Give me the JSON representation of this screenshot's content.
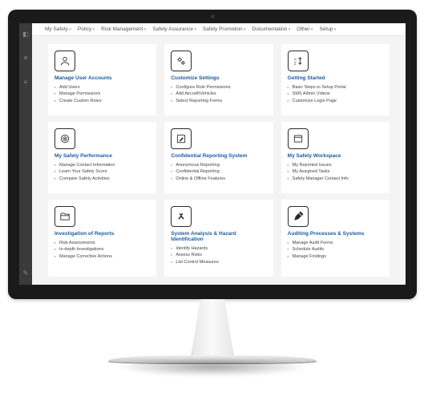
{
  "nav": [
    "My Safety",
    "Policy",
    "Risk Management",
    "Safety Assurance",
    "Safety Promotion",
    "Documentation",
    "Other",
    "Setup"
  ],
  "cards": [
    {
      "icon": "user",
      "title": "Manage User Accounts",
      "items": [
        "Add Users",
        "Manage Permissions",
        "Create Custom Roles"
      ]
    },
    {
      "icon": "gears",
      "title": "Customize Settings",
      "items": [
        "Configure Role Permissions",
        "Add Aircraft/Vehicles",
        "Select Reporting Forms"
      ]
    },
    {
      "icon": "az",
      "title": "Getting Started",
      "items": [
        "Basic Steps to Setup Portal",
        "SMS Admin Videos",
        "Customize Login Page"
      ]
    },
    {
      "icon": "target",
      "title": "My Safety Performance",
      "items": [
        "Manage Contact Information",
        "Learn Your Safety Score",
        "Compare Safety Activities"
      ]
    },
    {
      "icon": "edit",
      "title": "Confidential Reporting System",
      "items": [
        "Anonymous Reporting",
        "Confidential Reporting",
        "Online & Offline Features"
      ]
    },
    {
      "icon": "window",
      "title": "My Safety Workspace",
      "items": [
        "My Reported Issues",
        "My Assigned Tasks",
        "Safety Manager Contact Info"
      ]
    },
    {
      "icon": "folder",
      "title": "Investigation of Reports",
      "items": [
        "Risk Assessments",
        "In-depth Investigations",
        "Manage Corrective Actions"
      ]
    },
    {
      "icon": "hazard",
      "title": "System Analysis & Hazard Identification",
      "items": [
        "Identify Hazards",
        "Assess Risks",
        "List Control Measures"
      ]
    },
    {
      "icon": "pencil",
      "title": "Auditing Processes & Systems",
      "items": [
        "Manage Audit Forms",
        "Schedule Audits",
        "Manage Findings"
      ]
    }
  ]
}
